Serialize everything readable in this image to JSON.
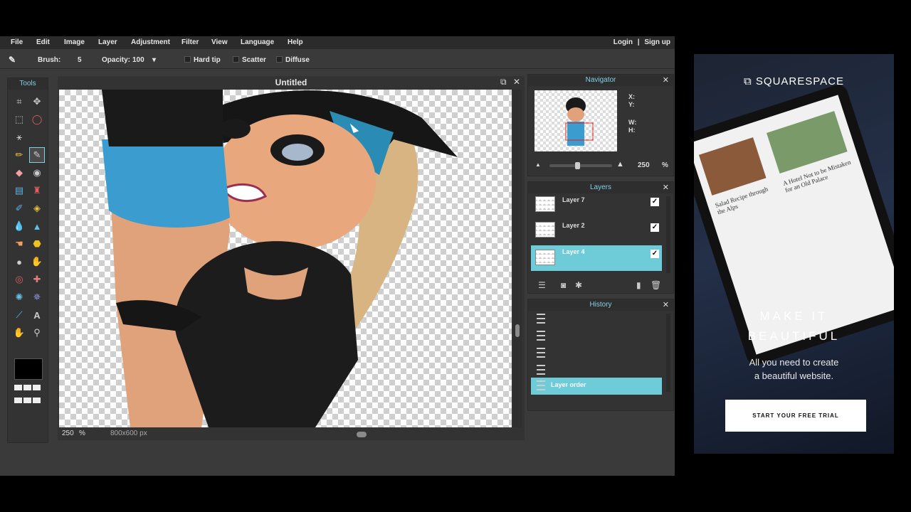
{
  "menu": [
    "File",
    "Edit",
    "Image",
    "Layer",
    "Adjustment",
    "Filter",
    "View",
    "Language",
    "Help"
  ],
  "auth": {
    "login": "Login",
    "separator": "|",
    "signup": "Sign up"
  },
  "options": {
    "brush_label": "Brush:",
    "brush_size": "5",
    "opacity_label": "Opacity:",
    "opacity_value": "100",
    "hard_tip": "Hard tip",
    "scatter": "Scatter",
    "diffuse": "Diffuse"
  },
  "tools": {
    "title": "Tools",
    "items": [
      "crop-icon",
      "move-icon",
      "marquee-icon",
      "lasso-icon",
      "magic-wand-icon",
      "pencil-icon",
      "brush-icon",
      "eraser-icon",
      "bucket-icon",
      "gradient-icon",
      "stamp-icon",
      "color-replace-icon",
      "drawing-icon",
      "blur-icon",
      "sharpen-icon",
      "smudge-icon",
      "sponge-icon",
      "dodge-icon",
      "burn-icon",
      "red-eye-icon",
      "spot-heal-icon",
      "bloat-icon",
      "pinch-icon",
      "color-picker-icon",
      "type-icon",
      "hand-icon",
      "zoom-icon"
    ],
    "foreground_color": "#000000"
  },
  "document": {
    "title": "Untitled",
    "zoom": "250",
    "zoom_unit": "%",
    "size": "800x600 px"
  },
  "navigator": {
    "title": "Navigator",
    "x_label": "X:",
    "y_label": "Y:",
    "w_label": "W:",
    "h_label": "H:",
    "zoom": "250",
    "zoom_unit": "%"
  },
  "layers": {
    "title": "Layers",
    "items": [
      {
        "name": "Layer 7",
        "visible": "✓"
      },
      {
        "name": "Layer 2",
        "visible": "✓"
      },
      {
        "name": "Layer 4",
        "visible": "✓"
      }
    ]
  },
  "history": {
    "title": "History",
    "items": [
      "Layer order"
    ]
  },
  "ad": {
    "brand": "SQUARESPACE",
    "headline1": "MAKE IT",
    "headline2": "BEAUTIFUL",
    "sub1": "All you need to create",
    "sub2": "a beautiful website.",
    "cta": "START YOUR FREE TRIAL",
    "screen_text1": "A Hotel Not to be Mistaken for an Old Palace",
    "screen_text2": "Salad Recipe through the Alps"
  },
  "colors": {
    "accent": "#6ecbd8",
    "panel_title": "#7fd0e6"
  }
}
